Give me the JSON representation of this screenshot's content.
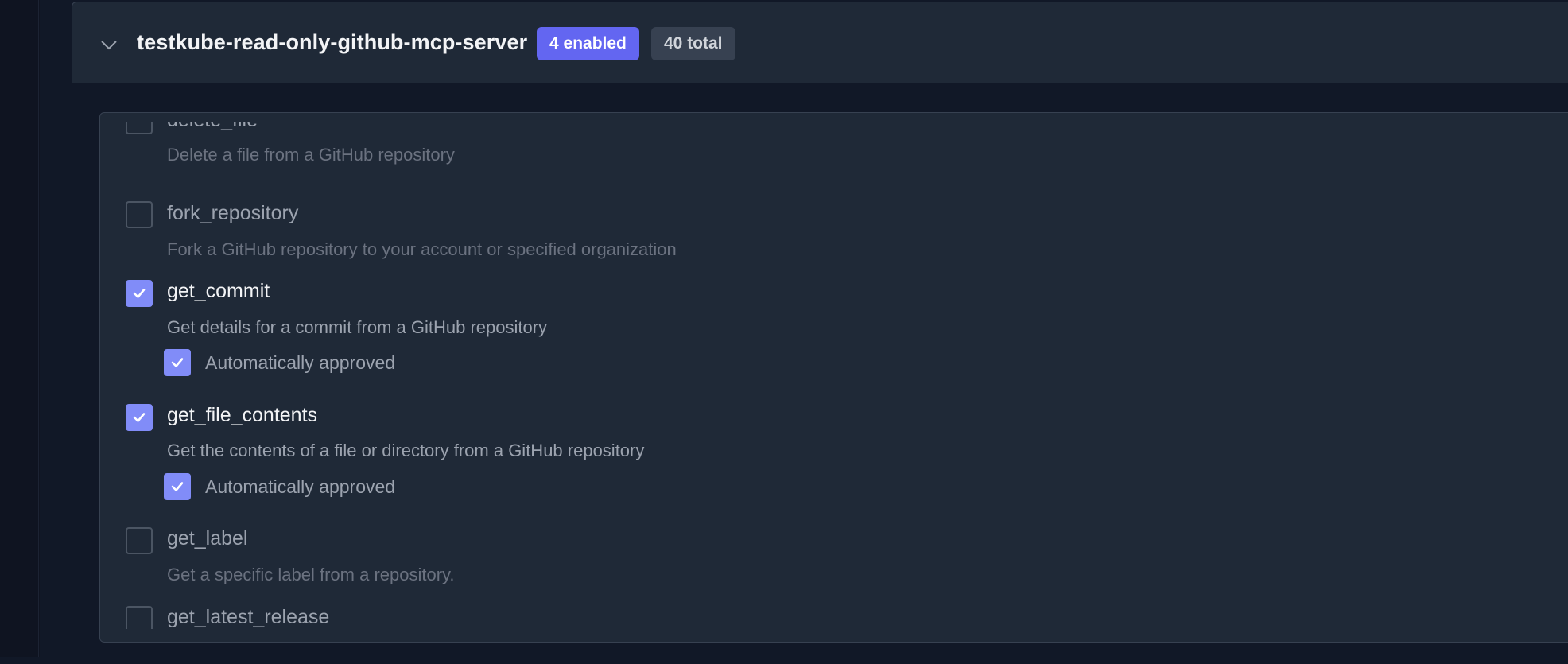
{
  "server": {
    "name": "testkube-read-only-github-mcp-server",
    "enabled_badge": "4 enabled",
    "total_badge": "40 total",
    "expanded": true
  },
  "tools": [
    {
      "name": "delete_file",
      "description": "Delete a file from a GitHub repository",
      "enabled": false
    },
    {
      "name": "fork_repository",
      "description": "Fork a GitHub repository to your account or specified organization",
      "enabled": false
    },
    {
      "name": "get_commit",
      "description": "Get details for a commit from a GitHub repository",
      "enabled": true,
      "auto_approve_label": "Automatically approved",
      "auto_approved": true
    },
    {
      "name": "get_file_contents",
      "description": "Get the contents of a file or directory from a GitHub repository",
      "enabled": true,
      "auto_approve_label": "Automatically approved",
      "auto_approved": true
    },
    {
      "name": "get_label",
      "description": "Get a specific label from a repository.",
      "enabled": false
    },
    {
      "name": "get_latest_release",
      "description": "",
      "enabled": false
    }
  ],
  "colors": {
    "accent": "#6366f1",
    "checkbox_checked": "#818cf8",
    "background": "#111827",
    "panel": "#1f2937"
  },
  "icons": {
    "collapse": "chevron-down-icon",
    "check": "check-icon"
  }
}
